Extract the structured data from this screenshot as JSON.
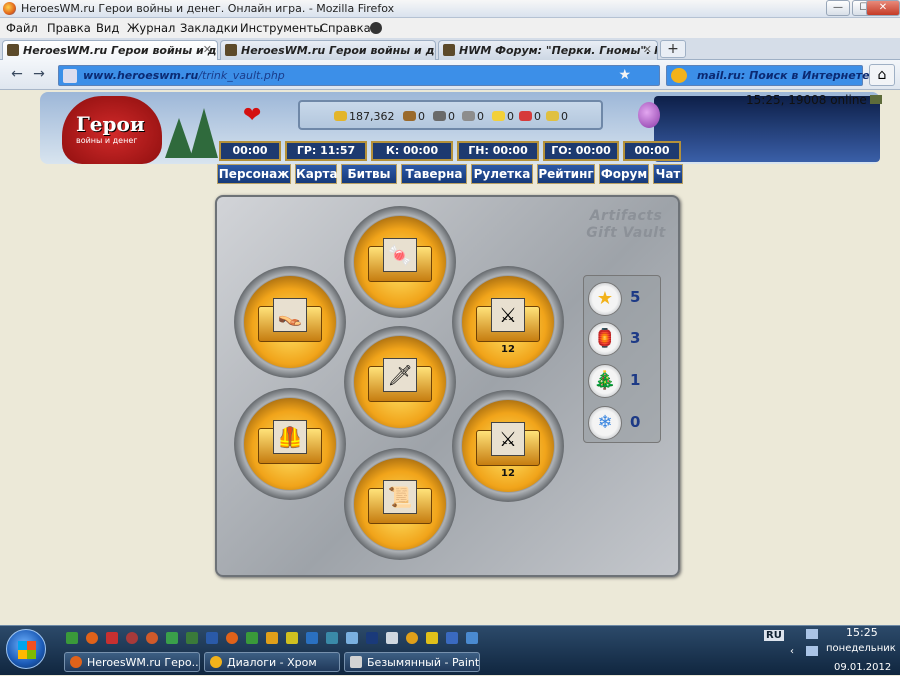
{
  "window": {
    "title": "HeroesWM.ru Герои войны и денег. Онлайн игра. - Mozilla Firefox",
    "controls": {
      "minimize": "—",
      "maximize": "☐",
      "close": "✕"
    }
  },
  "menu": [
    "Файл",
    "Правка",
    "Вид",
    "Журнал",
    "Закладки",
    "Инструменты",
    "Справка"
  ],
  "tabs": [
    {
      "label": "HeroesWM.ru Герои войны и денег...",
      "active": true
    },
    {
      "label": "HeroesWM.ru Герои войны и денег...",
      "active": false
    },
    {
      "label": "HWM Форум: \"Перки. Гномы\". Не...",
      "active": false
    }
  ],
  "toolbar": {
    "back": "←",
    "forward": "→",
    "url_host": "www.heroeswm.ru",
    "url_path": "/trink_vault.php",
    "search_text": "mail.ru: Поиск в Интернете",
    "home": "⌂",
    "new_tab": "+",
    "tab_close": "✕",
    "bookmark_star": "★"
  },
  "game": {
    "logo_text": "Герои",
    "logo_subtext": "войны и денег",
    "status": "15:25, 19008 online",
    "resources": [
      {
        "icon": "gold-icon",
        "value": "187,362",
        "color": "#e3b52a"
      },
      {
        "icon": "wood-icon",
        "value": "0",
        "color": "#9a6a2c"
      },
      {
        "icon": "ore-icon",
        "value": "0",
        "color": "#6a6a6a"
      },
      {
        "icon": "mercury-icon",
        "value": "0",
        "color": "#8d8d8d"
      },
      {
        "icon": "sulfur-icon",
        "value": "0",
        "color": "#f2d03a"
      },
      {
        "icon": "crystal-icon",
        "value": "0",
        "color": "#d63a3a"
      },
      {
        "icon": "gems-icon",
        "value": "0",
        "color": "#e0c040"
      }
    ],
    "timers": [
      "00:00",
      "ГР: 11:57",
      "К: 00:00",
      "ГН: 00:00",
      "ГО: 00:00",
      "00:00"
    ],
    "nav": [
      "Персонаж",
      "Карта",
      "Битвы",
      "Таверна",
      "Рулетка",
      "Рейтинг",
      "Форум",
      "Чат"
    ],
    "vault_title": "Artifacts Gift Vault",
    "chests": [
      {
        "item": "candy-icon",
        "glyph": "🍬",
        "count": ""
      },
      {
        "item": "slippers-icon",
        "glyph": "👡",
        "count": ""
      },
      {
        "item": "crossed-swords-icon",
        "glyph": "⚔",
        "count": "12"
      },
      {
        "item": "dagger-icon",
        "glyph": "🗡",
        "count": ""
      },
      {
        "item": "armor-icon",
        "glyph": "🦺",
        "count": ""
      },
      {
        "item": "crossed-swords-icon",
        "glyph": "⚔",
        "count": "12"
      },
      {
        "item": "scroll-icon",
        "glyph": "📜",
        "count": ""
      }
    ],
    "tokens": [
      {
        "icon": "star-icon",
        "glyph": "★",
        "color": "#f2b21a",
        "value": "5"
      },
      {
        "icon": "lantern-icon",
        "glyph": "🏮",
        "color": "#e04a1a",
        "value": "3"
      },
      {
        "icon": "tree-icon",
        "glyph": "🎄",
        "color": "#2f7a3a",
        "value": "1"
      },
      {
        "icon": "snowflake-icon",
        "glyph": "❄",
        "color": "#3a86e0",
        "value": "0"
      }
    ]
  },
  "taskbar": {
    "tasks": [
      {
        "label": "HeroesWM.ru Геро...",
        "color": "#e0621a"
      },
      {
        "label": "Диалоги - Хром",
        "color": "#f2b21a"
      },
      {
        "label": "Безымянный - Paint",
        "color": "#d3d3d3"
      }
    ],
    "lang": "RU",
    "time": "15:25",
    "day": "понедельник",
    "date": "09.01.2012"
  }
}
